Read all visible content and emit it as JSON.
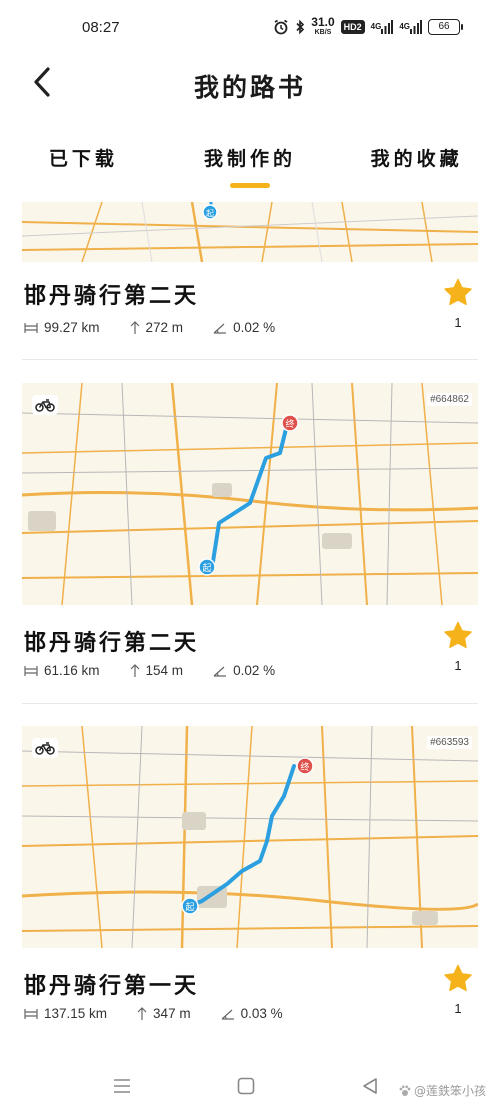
{
  "status_bar": {
    "time": "08:27",
    "net_speed_value": "31.0",
    "net_speed_unit": "KB/S",
    "hd_label": "HD2",
    "signal_1": "4G",
    "signal_2": "4G",
    "battery": "66"
  },
  "header": {
    "title": "我的路书"
  },
  "tabs": [
    {
      "label": "已下载",
      "active": false
    },
    {
      "label": "我制作的",
      "active": true
    },
    {
      "label": "我的收藏",
      "active": false
    }
  ],
  "routes": [
    {
      "title": "邯丹骑行第二天",
      "distance": "99.27 km",
      "elevation": "272 m",
      "grade": "0.02 %",
      "favorites": "1",
      "map_id": ""
    },
    {
      "title": "邯丹骑行第二天",
      "distance": "61.16 km",
      "elevation": "154 m",
      "grade": "0.02 %",
      "favorites": "1",
      "map_id": "#664862"
    },
    {
      "title": "邯丹骑行第一天",
      "distance": "137.15 km",
      "elevation": "347 m",
      "grade": "0.03 %",
      "favorites": "1",
      "map_id": "#663593"
    }
  ],
  "map_markers": {
    "start": "起",
    "end": "终"
  },
  "colors": {
    "accent": "#f5b21b",
    "route_line": "#2b9fe0",
    "map_bg": "#fbf6ea",
    "road": "#f0b04a"
  },
  "watermark": "@莲鉄笨小孩"
}
